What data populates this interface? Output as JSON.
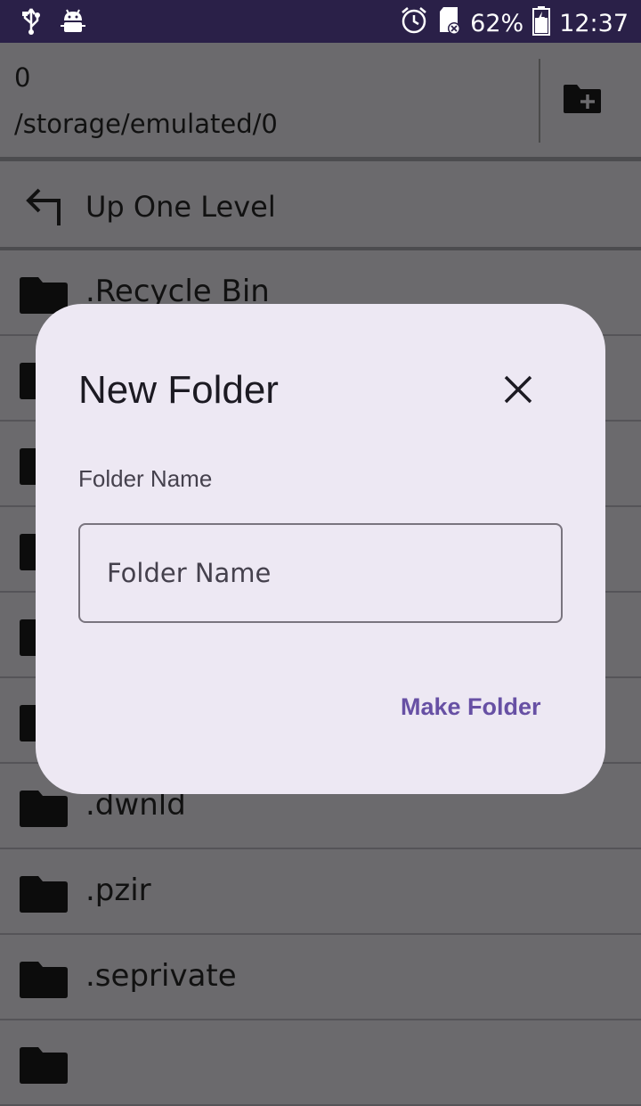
{
  "status_bar": {
    "battery": "62%",
    "time": "12:37",
    "icons": [
      "usb-icon",
      "android-debug-icon",
      "alarm-icon",
      "sd-card-icon",
      "battery-charging-icon"
    ]
  },
  "header": {
    "folder_name": "0",
    "path": "/storage/emulated/0",
    "new_folder_icon": "create-new-folder-icon"
  },
  "up_one_level": {
    "label": "Up One Level"
  },
  "list": {
    "items": [
      {
        "name": ".Recycle Bin"
      },
      {
        "name": ""
      },
      {
        "name": ""
      },
      {
        "name": ""
      },
      {
        "name": ""
      },
      {
        "name": ""
      },
      {
        "name": ".dwnld"
      },
      {
        "name": ".pzir"
      },
      {
        "name": ".seprivate"
      },
      {
        "name": ""
      }
    ]
  },
  "dialog": {
    "title": "New Folder",
    "field_label": "Folder Name",
    "input_value": "",
    "input_placeholder": "Folder Name",
    "action_label": "Make Folder"
  },
  "colors": {
    "status_bar": "#2a2048",
    "background": "#6b6a6d",
    "dialog_bg": "#ede8f3",
    "accent": "#6750a4"
  }
}
